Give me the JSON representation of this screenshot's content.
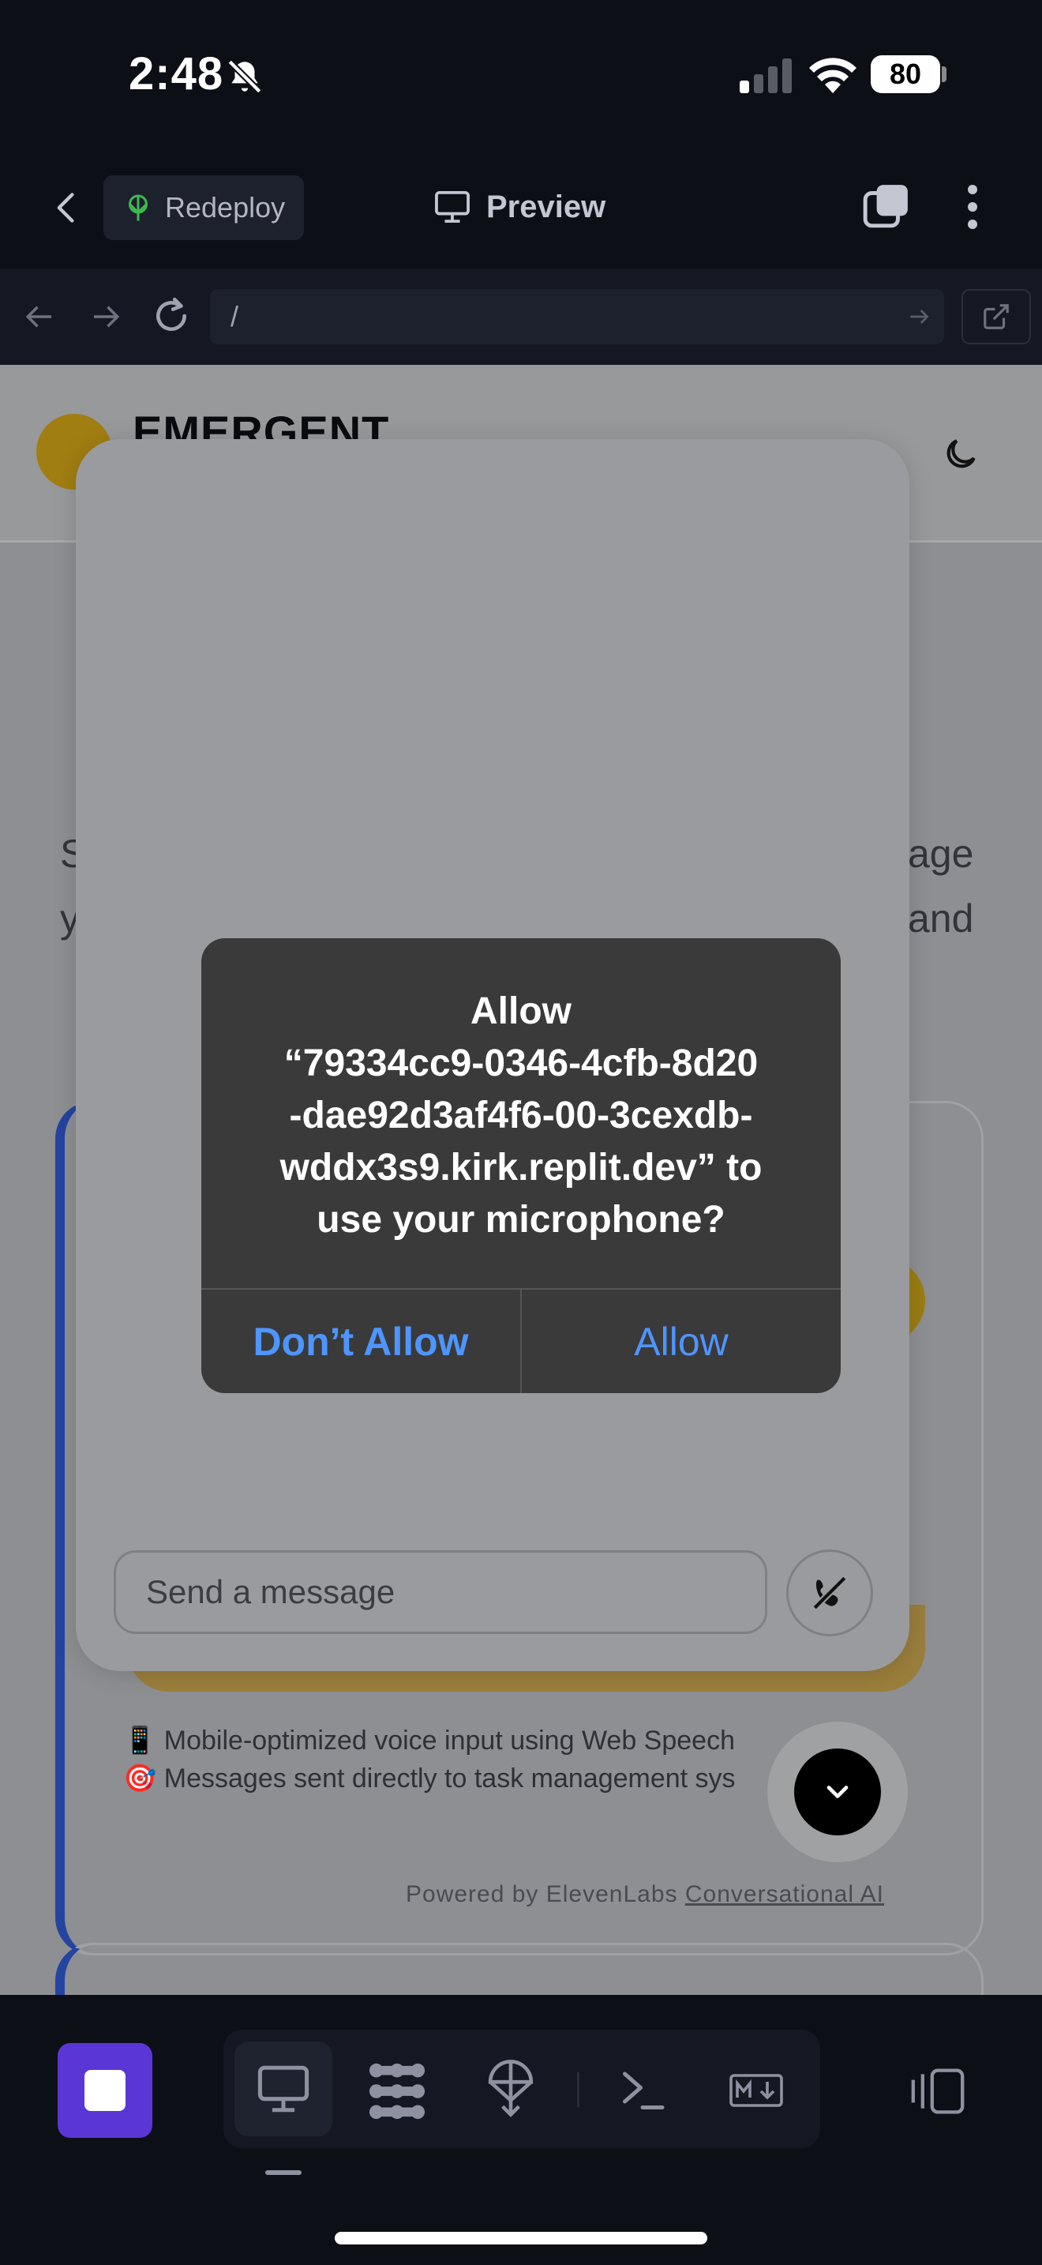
{
  "status_bar": {
    "time": "2:48",
    "battery": "80"
  },
  "top_bar": {
    "redeploy_label": "Redeploy",
    "preview_label": "Preview"
  },
  "url_bar": {
    "url": "/"
  },
  "web_page": {
    "brand": "EMERGENT",
    "bg_fragments": [
      "S",
      "y",
      "age",
      "and"
    ],
    "features": [
      "📱 Mobile-optimized voice input using Web Speech",
      "🎯 Messages sent directly to task management sys"
    ],
    "powered_prefix": "Powered by ElevenLabs ",
    "powered_link": "Conversational AI"
  },
  "chat": {
    "input_placeholder": "Send a message"
  },
  "alert": {
    "title_lines": [
      "Allow",
      "“79334cc9-0346-4cfb-8d20",
      "-dae92d3af4f6-00-3cexdb-",
      "wddx3s9.kirk.replit.dev” to",
      "use your microphone?"
    ],
    "dont_allow_label": "Don’t Allow",
    "allow_label": "Allow"
  },
  "colors": {
    "accent_blue": "#4e95ff",
    "stop_purple": "#5b36d6",
    "background": "#0d0f17"
  },
  "icons": [
    "bell-off-icon",
    "signal-icon",
    "wifi-icon",
    "back-chevron-icon",
    "redeploy-icon",
    "monitor-icon",
    "tabs-icon",
    "more-vertical-icon",
    "arrow-left-icon",
    "arrow-right-icon",
    "reload-icon",
    "external-link-icon",
    "moon-icon",
    "phone-off-icon",
    "chevron-down-icon",
    "stop-icon",
    "workflows-icon",
    "deploy-icon",
    "shell-icon",
    "markdown-icon",
    "panel-icon"
  ]
}
